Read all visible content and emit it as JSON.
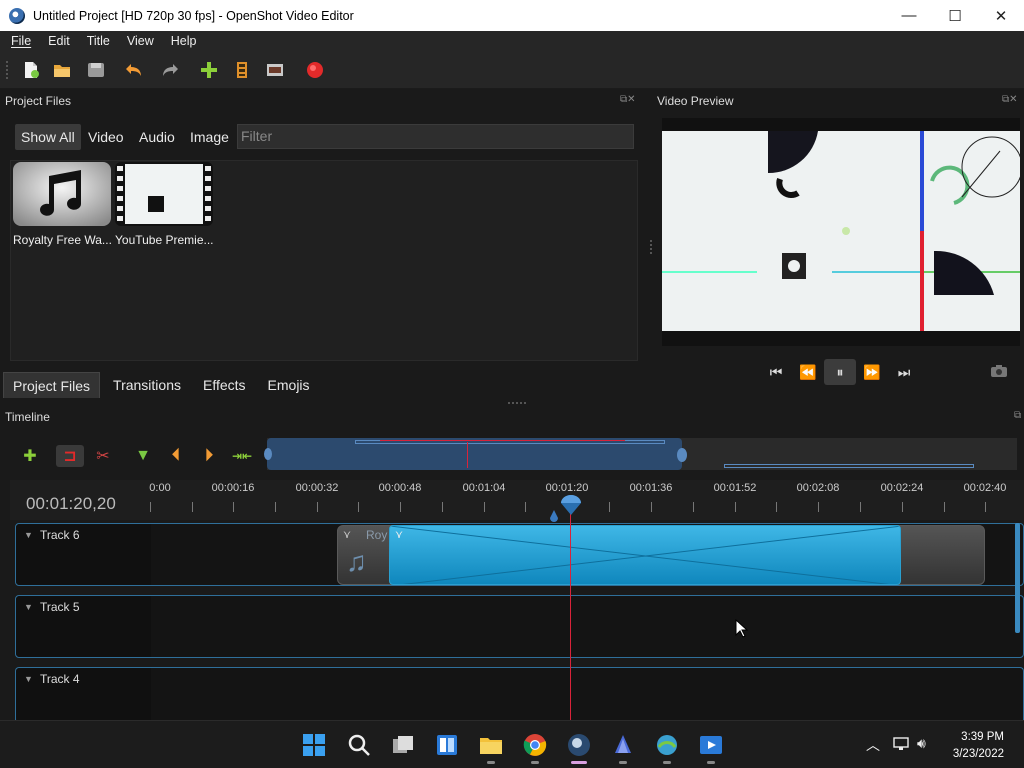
{
  "window": {
    "title": "Untitled Project [HD 720p 30 fps] - OpenShot Video Editor",
    "controls": {
      "minimize": "—",
      "maximize": "☐",
      "close": "✕"
    }
  },
  "menu": [
    "File",
    "Edit",
    "Title",
    "View",
    "Help"
  ],
  "toolbar": {
    "icons": [
      "new-project-icon",
      "open-project-icon",
      "save-project-icon",
      "undo-icon",
      "redo-icon",
      "import-files-icon",
      "choose-profile-icon",
      "fullscreen-icon",
      "export-video-icon"
    ]
  },
  "project_files": {
    "title": "Project Files",
    "filter_tabs": [
      "Show All",
      "Video",
      "Audio",
      "Image"
    ],
    "active_filter": "Show All",
    "filter_placeholder": "Filter",
    "files": [
      {
        "name": "Royalty Free Wa...",
        "type": "audio"
      },
      {
        "name": "YouTube Premie...",
        "type": "video"
      }
    ]
  },
  "bottom_tabs": [
    "Project Files",
    "Transitions",
    "Effects",
    "Emojis"
  ],
  "active_bottom_tab": "Project Files",
  "video_preview": {
    "title": "Video Preview",
    "controls": [
      "jump-start-icon",
      "rewind-icon",
      "pause-icon",
      "fast-forward-icon",
      "jump-end-icon"
    ],
    "camera": "camera-icon"
  },
  "timeline": {
    "title": "Timeline",
    "timecode": "00:01:20,20",
    "ticks": [
      "0:00",
      "00:00:16",
      "00:00:32",
      "00:00:48",
      "00:01:04",
      "00:01:20",
      "00:01:36",
      "00:01:52",
      "00:02:08",
      "00:02:24",
      "00:02:40"
    ],
    "tracks": [
      {
        "name": "Track 6"
      },
      {
        "name": "Track 5"
      },
      {
        "name": "Track 4"
      }
    ],
    "clip_label": "Roy",
    "tool_icons": [
      "add-track-icon",
      "snapping-icon",
      "razor-icon",
      "add-marker-icon",
      "previous-marker-icon",
      "next-marker-icon",
      "center-playhead-icon"
    ]
  },
  "taskbar": {
    "time": "3:39 PM",
    "date": "3/23/2022",
    "apps": [
      "start-icon",
      "search-icon",
      "task-view-icon",
      "widgets-icon",
      "file-explorer-icon",
      "chrome-icon",
      "openshot-icon",
      "app-icon",
      "app2-icon",
      "media-player-icon"
    ],
    "tray": [
      "chevron-up-icon",
      "network-icon",
      "volume-icon"
    ]
  },
  "colors": {
    "accent_blue": "#2f6f9a",
    "playhead_red": "#d9233a",
    "clip_cyan": "#1fa6d8"
  }
}
